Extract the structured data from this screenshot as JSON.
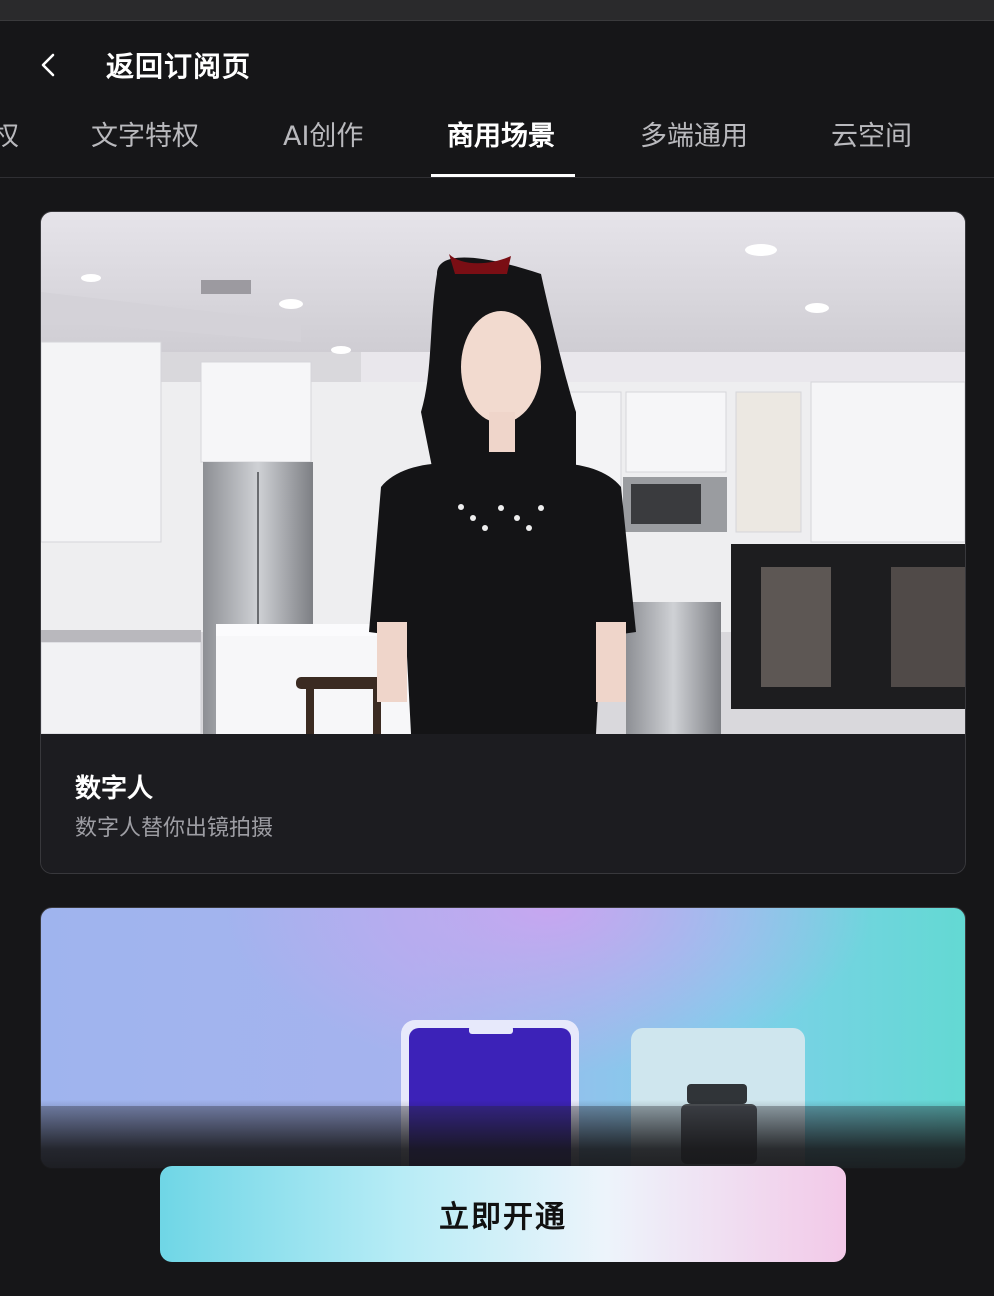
{
  "header": {
    "title": "返回订阅页",
    "back_icon": "chevron-left-icon"
  },
  "tabs": [
    {
      "label": "权",
      "active": false
    },
    {
      "label": "文字特权",
      "active": false
    },
    {
      "label": "AI创作",
      "active": false
    },
    {
      "label": "商用场景",
      "active": true
    },
    {
      "label": "多端通用",
      "active": false
    },
    {
      "label": "云空间",
      "active": false
    }
  ],
  "cards": [
    {
      "title": "数字人",
      "subtitle": "数字人替你出镜拍摄"
    },
    {
      "title": "",
      "subtitle": ""
    }
  ],
  "cta": {
    "label": "立即开通"
  },
  "colors": {
    "background": "#161618",
    "card": "#1c1c20",
    "cta_start": "#6fd6e6",
    "cta_end": "#f3c9e8"
  }
}
